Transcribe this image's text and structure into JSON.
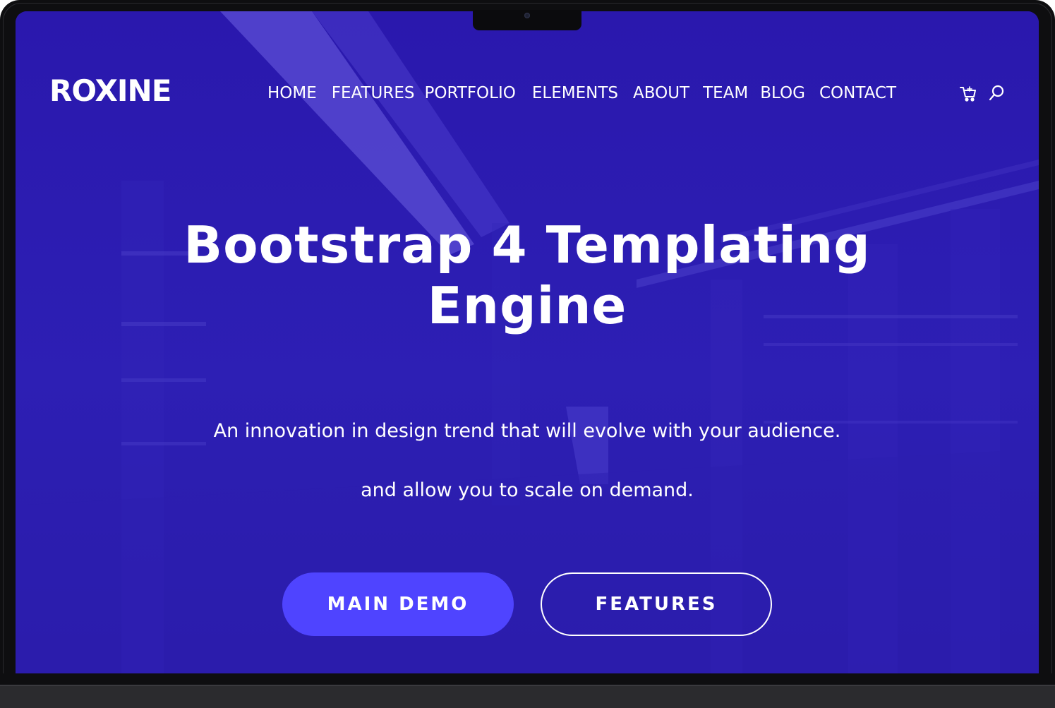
{
  "brand": {
    "logo": "ROXINE"
  },
  "nav": {
    "items": [
      {
        "label": "HOME"
      },
      {
        "label": "FEATURES"
      },
      {
        "label": "PORTFOLIO"
      },
      {
        "label": "ELEMENTS"
      },
      {
        "label": "ABOUT"
      },
      {
        "label": "TEAM"
      },
      {
        "label": "BLOG"
      },
      {
        "label": "CONTACT"
      }
    ],
    "icons": [
      "cart-icon",
      "search-icon"
    ]
  },
  "hero": {
    "title_line1": "Bootstrap 4 Templating",
    "title_line2": "Engine",
    "subtitle_line1": "An innovation in design trend that will evolve with your audience.",
    "subtitle_line2": "and allow you to scale on demand.",
    "primary_button": "MAIN DEMO",
    "secondary_button": "FEATURES"
  },
  "colors": {
    "background_overlay": "#2b1bb0",
    "primary_button": "#4f44ff",
    "text": "#ffffff",
    "device_frame": "#0e0e10"
  }
}
